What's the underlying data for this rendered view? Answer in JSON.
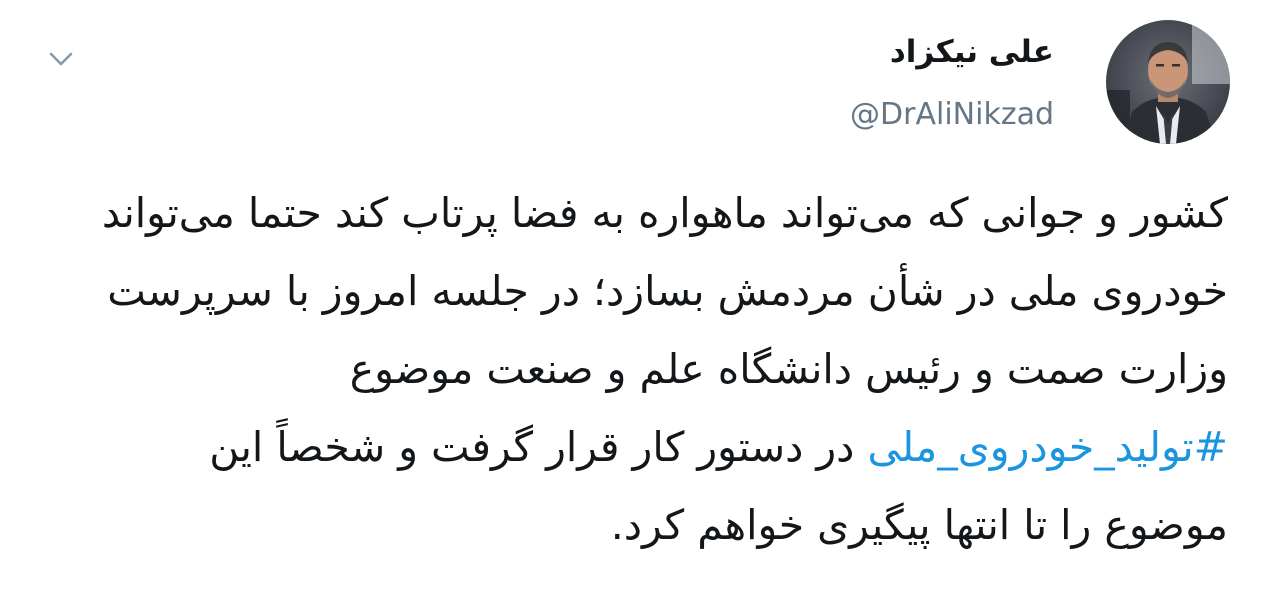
{
  "tweet": {
    "display_name": "علی نیکزاد",
    "handle": "@DrAliNikzad",
    "avatar_icon": "profile-photo",
    "menu_icon": "chevron-down-icon",
    "text_before": "کشور و جوانی که می‌تواند ماهواره به فضا پرتاب کند حتما می‌تواند خودروی ملی در شأن مردمش بسازد؛ در جلسه امروز با سرپرست وزارت صمت و رئیس دانشگاه علم و صنعت موضوع",
    "hashtag": "#تولید_خودروی_ملی",
    "text_after": "در دستور کار قرار گرفت و شخصاً این موضوع را تا انتها پیگیری خواهم کرد.",
    "colors": {
      "text": "#14171a",
      "handle": "#657786",
      "link": "#1b95e0",
      "chevron": "#8899a6"
    }
  }
}
